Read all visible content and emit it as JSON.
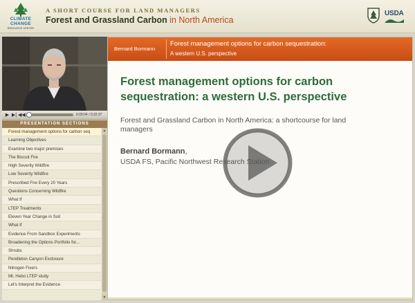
{
  "header": {
    "logo": {
      "line1": "CLIMATE",
      "line2": "CHANGE",
      "line3": "RESOURCE CENTER",
      "icon": "climate-change-logo"
    },
    "subtitle": "A SHORT COURSE FOR LAND MANAGERS",
    "title_main": "Forest and Grassland Carbon",
    "title_accent": " in North America",
    "usfs_icon": "usfs-shield-icon",
    "usda_label": "USDA"
  },
  "video": {
    "controls": {
      "play": "play-icon",
      "next": "next-icon",
      "rewind": "rewind-icon"
    },
    "time": "0:00:04 / 0:22:37",
    "progress_fraction": 0.003
  },
  "sections": {
    "header": "PRESENTATION SECTIONS",
    "items": [
      "Forest management options for carbon seq",
      "Learning Objectives",
      "Examine two major premises",
      "The Biscuit Fire",
      "High Severity Wildfire",
      "Low Severity Wildfire",
      "Prescribed Fire Every 20 Years",
      "Questions Concerning Wildfire",
      "What If",
      "LTEP Treatments",
      "Eleven Year Change in Soil",
      "What If",
      "Evidence From Sandbox Experiments",
      "Broadening the Options Portfolio for...",
      "Shrubs",
      "Pendleton Canyon Exclosure",
      "Nitrogen Fixers",
      "Mt. Hebo LTEP study",
      "Let's Interpret the Evidence"
    ]
  },
  "slide": {
    "header_speaker": "Bernard Bormann",
    "header_title": "Forest management options for carbon sequestration:",
    "header_subtitle": "A western U.S. perspective",
    "title": "Forest management options for carbon sequestration: a western U.S. perspective",
    "subtitle": "Forest and Grassland Carbon in North America: a shortcourse for land managers",
    "author": "Bernard Bormann",
    "author_suffix": ",",
    "affiliation": "USDA FS, Pacific Northwest Research Station",
    "play_icon": "big-play-icon"
  },
  "colors": {
    "accent": "#d2581a",
    "title_green": "#2f6b3a",
    "panel_tan": "#9a7c52"
  }
}
